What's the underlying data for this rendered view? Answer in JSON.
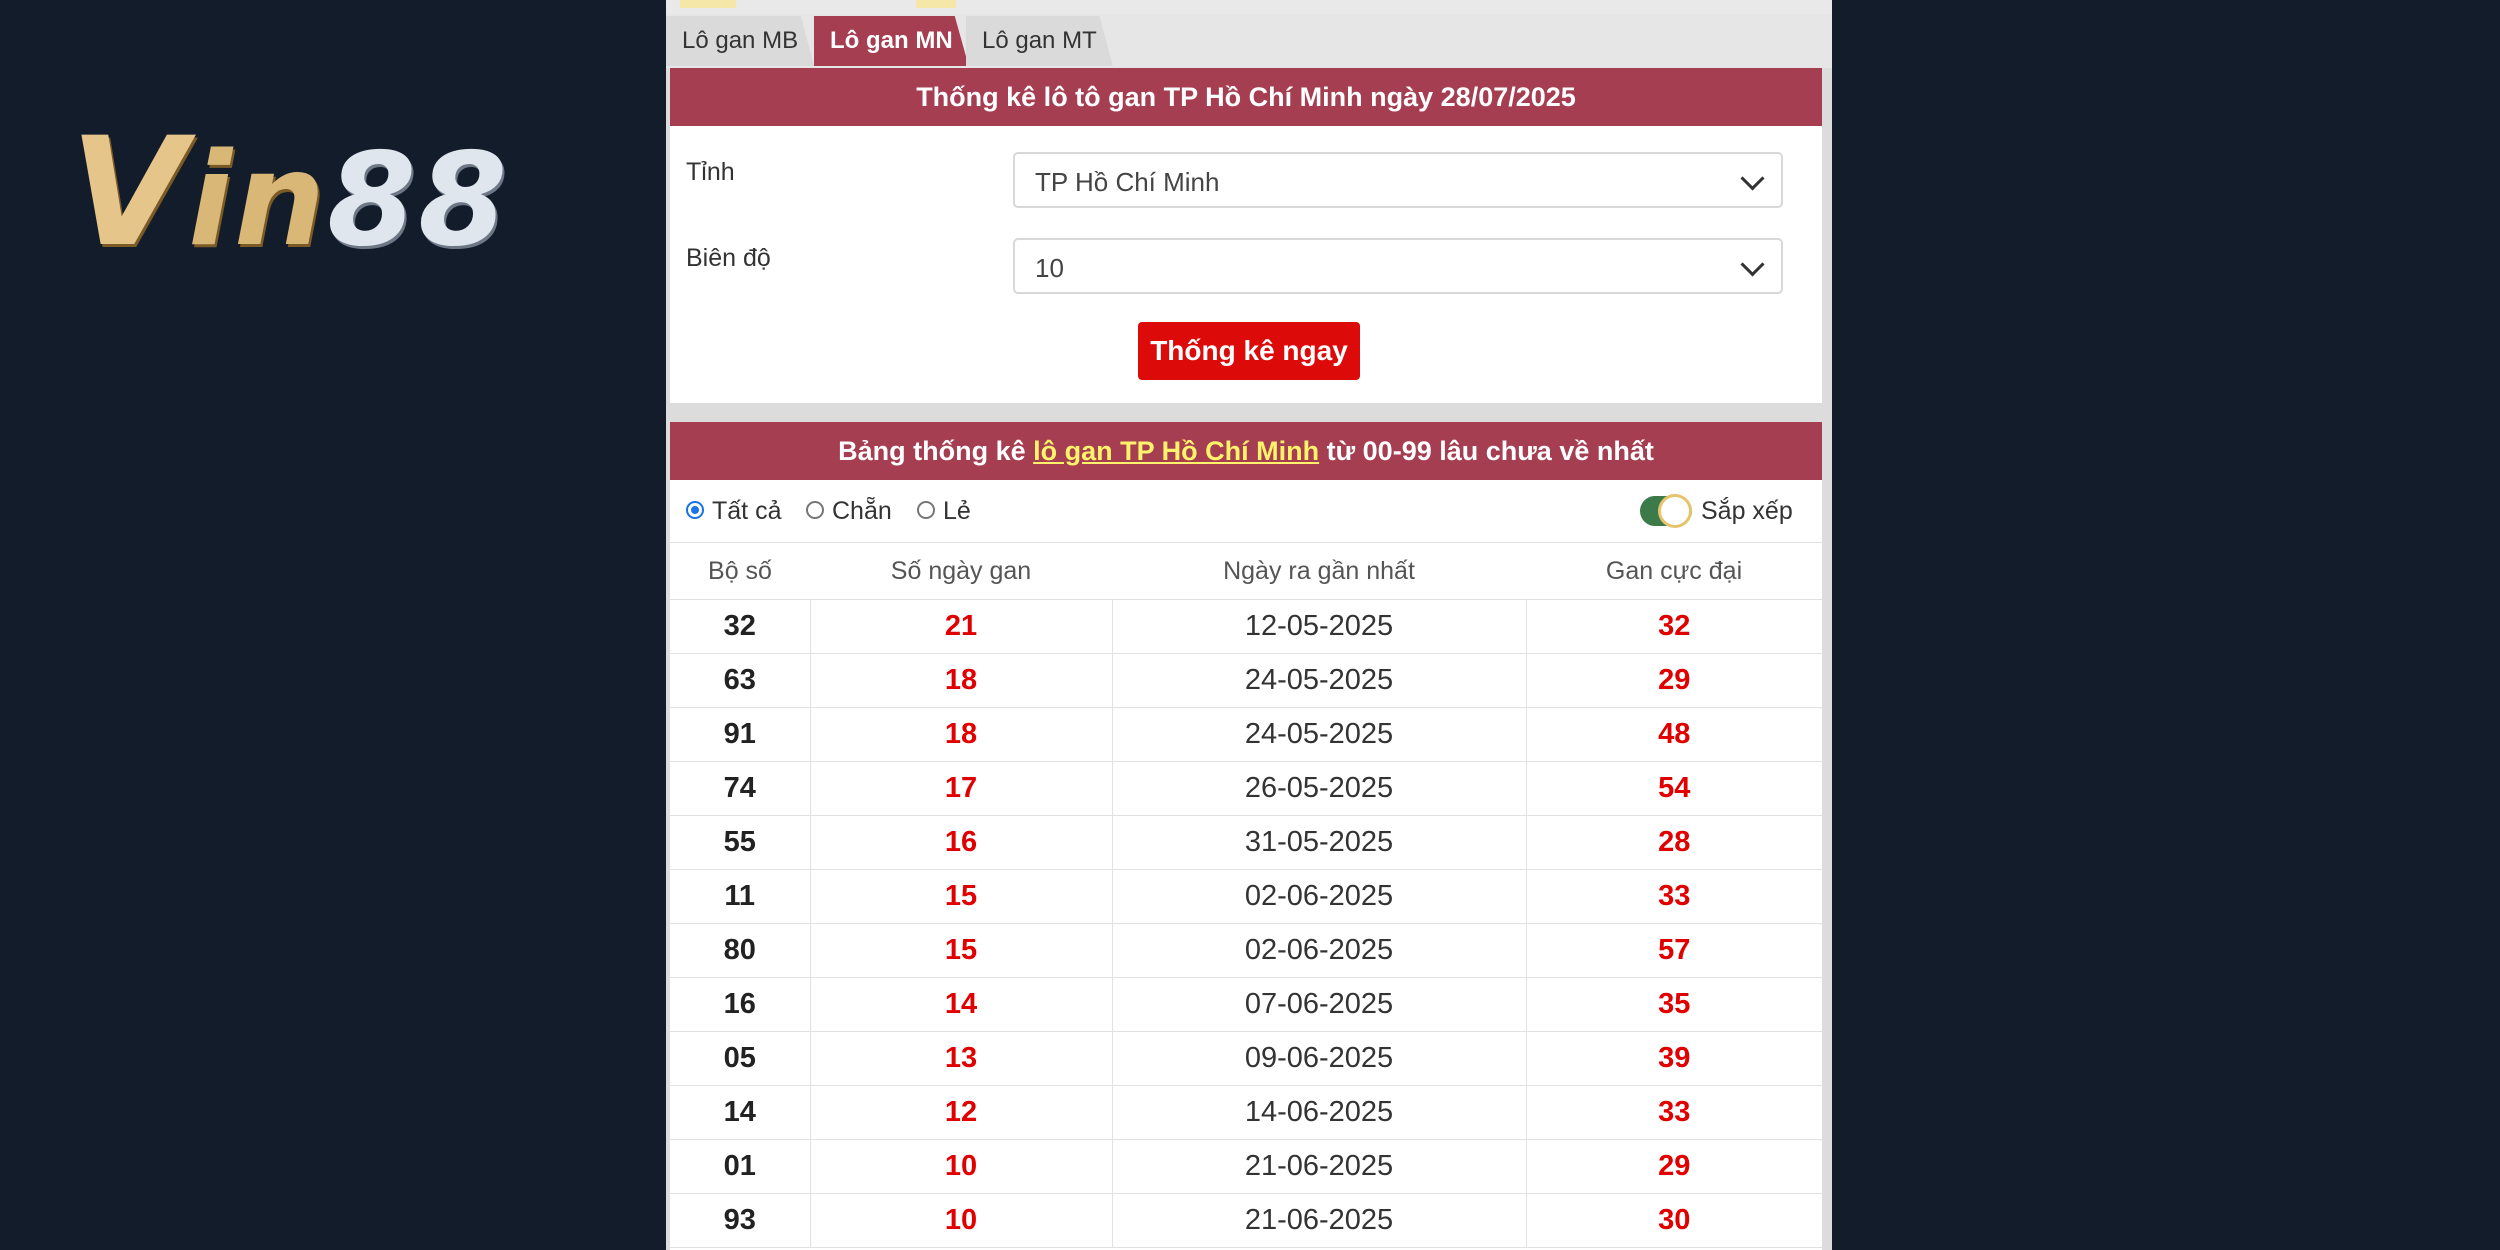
{
  "logo": {
    "v": "V",
    "in": "in",
    "n88": "88"
  },
  "tabs": [
    "Lô gan MB",
    "Lô gan MN",
    "Lô gan MT"
  ],
  "active_tab": "Lô gan MN",
  "form": {
    "title": "Thống kê lô tô gan TP Hồ Chí Minh ngày 28/07/2025",
    "province_label": "Tỉnh",
    "province_value": "TP Hồ Chí Minh",
    "range_label": "Biên độ",
    "range_value": "10",
    "submit_label": "Thống kê ngay"
  },
  "table_header": {
    "prefix": "Bảng thống kê ",
    "link": "lô gan TP Hồ Chí Minh",
    "suffix": " từ 00-99 lâu chưa về nhất"
  },
  "filters": {
    "all": "Tất cả",
    "even": "Chẵn",
    "odd": "Lẻ",
    "selected": "all",
    "sort_label": "Sắp xếp",
    "sort_on": true
  },
  "columns": [
    "Bộ số",
    "Số ngày gan",
    "Ngày ra gần nhất",
    "Gan cực đại"
  ],
  "rows": [
    [
      "32",
      "21",
      "12-05-2025",
      "32"
    ],
    [
      "63",
      "18",
      "24-05-2025",
      "29"
    ],
    [
      "91",
      "18",
      "24-05-2025",
      "48"
    ],
    [
      "74",
      "17",
      "26-05-2025",
      "54"
    ],
    [
      "55",
      "16",
      "31-05-2025",
      "28"
    ],
    [
      "11",
      "15",
      "02-06-2025",
      "33"
    ],
    [
      "80",
      "15",
      "02-06-2025",
      "57"
    ],
    [
      "16",
      "14",
      "07-06-2025",
      "35"
    ],
    [
      "05",
      "13",
      "09-06-2025",
      "39"
    ],
    [
      "14",
      "12",
      "14-06-2025",
      "33"
    ],
    [
      "01",
      "10",
      "21-06-2025",
      "29"
    ],
    [
      "93",
      "10",
      "21-06-2025",
      "30"
    ]
  ]
}
